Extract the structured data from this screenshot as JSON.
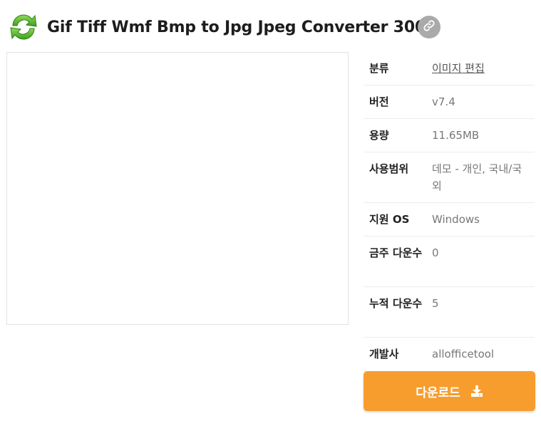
{
  "header": {
    "title": "Gif Tiff Wmf Bmp to Jpg Jpeg Converter 3000",
    "app_icon": "refresh-arrows-icon",
    "link_icon": "link-icon"
  },
  "preview": {
    "content": ""
  },
  "info": {
    "rows": [
      {
        "label": "분류",
        "value": "이미지 편집",
        "is_link": true
      },
      {
        "label": "버전",
        "value": "v7.4"
      },
      {
        "label": "용량",
        "value": "11.65MB"
      },
      {
        "label": "사용범위",
        "value": "데모 - 개인, 국내/국외"
      },
      {
        "label": "지원 OS",
        "value": "Windows"
      },
      {
        "label": "금주 다운수",
        "value": "0"
      },
      {
        "label": "누적 다운수",
        "value": "5"
      },
      {
        "label": "개발사",
        "value": "allofficetool"
      }
    ]
  },
  "download": {
    "label": "다운로드",
    "icon": "download-icon"
  },
  "colors": {
    "accent": "#f79d2e",
    "icon_green": "#5cb82e",
    "link_bg": "#aaaaaa"
  }
}
